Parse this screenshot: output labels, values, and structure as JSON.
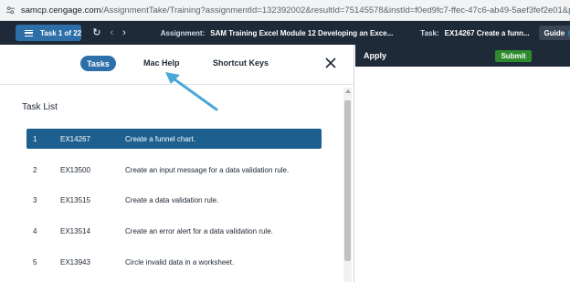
{
  "browser": {
    "url_host": "samcp.cengage.com",
    "url_path": "/AssignmentTake/Training?assignmentId=132392002&resultId=75145578&instId=f0ed9fc7-ffec-47c6-ab49-5aef3fef2e01&pid=6437978..."
  },
  "appbar": {
    "task_counter": "Task 1 of 22",
    "assignment_label": "Assignment:",
    "assignment_value": "SAM Training Excel Module 12 Developing an Exce...",
    "task_label": "Task:",
    "task_value": "EX14267 Create a funn...",
    "guide_label": "Guide",
    "guide_icon_text": "?"
  },
  "tabs": {
    "tasks": "Tasks",
    "mac_help": "Mac Help",
    "shortcut_keys": "Shortcut Keys"
  },
  "task_list": {
    "title": "Task List",
    "items": [
      {
        "num": "1",
        "code": "EX14267",
        "desc": "Create a funnel chart."
      },
      {
        "num": "2",
        "code": "EX13500",
        "desc": "Create an input message for a data validation rule."
      },
      {
        "num": "3",
        "code": "EX13515",
        "desc": "Create a data validation rule."
      },
      {
        "num": "4",
        "code": "EX13514",
        "desc": "Create an error alert for a data validation rule."
      },
      {
        "num": "5",
        "code": "EX13943",
        "desc": "Circle invalid data in a worksheet."
      }
    ]
  },
  "right": {
    "apply": "Apply",
    "submit": "Submit"
  },
  "colors": {
    "appbar": "#1f2a38",
    "accent": "#2d6fa8",
    "active_row": "#1d5f8f",
    "submit": "#2e8b2e",
    "annotation_arrow": "#4aa8d8"
  }
}
